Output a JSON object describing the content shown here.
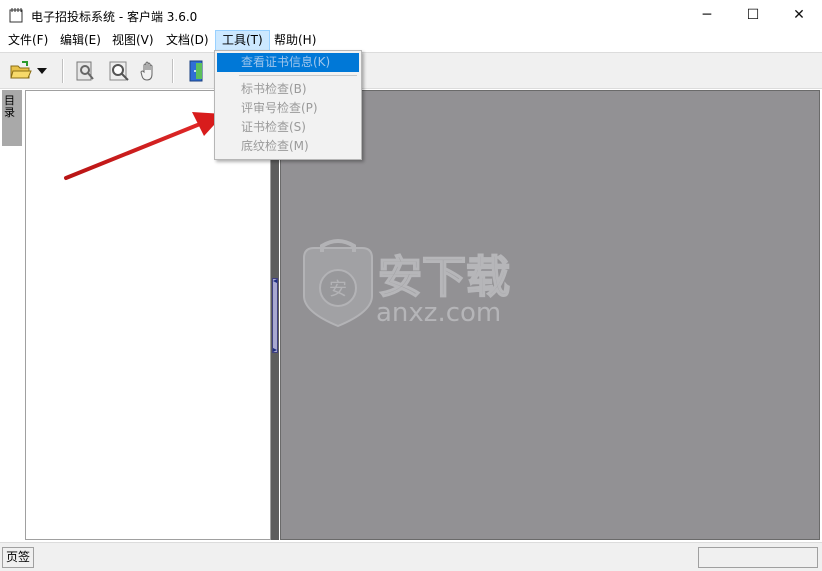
{
  "window": {
    "title": "电子招投标系统 - 客户端 3.6.0",
    "minimize_glyph": "─",
    "maximize_glyph": "☐",
    "close_glyph": "✕"
  },
  "menubar": {
    "items": [
      {
        "label": "文件(F)"
      },
      {
        "label": "编辑(E)"
      },
      {
        "label": "视图(V)"
      },
      {
        "label": "文档(D)"
      },
      {
        "label": "工具(T)",
        "active": true
      },
      {
        "label": "帮助(H)"
      }
    ]
  },
  "tools_menu": {
    "items": [
      {
        "label": "查看证书信息(K)",
        "highlighted": true
      },
      {
        "label": "标书检查(B)",
        "enabled": false
      },
      {
        "label": "评审号检查(P)",
        "enabled": false
      },
      {
        "label": "证书检查(S)",
        "enabled": false
      },
      {
        "label": "底纹检查(M)",
        "enabled": false
      }
    ]
  },
  "toolbar": {
    "icons": [
      "open-folder-icon",
      "dropdown-arrow-icon",
      "find-icon",
      "zoom-icon",
      "hand-icon",
      "exit-door-icon"
    ]
  },
  "side_tab": {
    "label": "目录"
  },
  "statusbar": {
    "page_tab_label": "页签"
  },
  "watermark": {
    "text": "anxz.com",
    "brand": "安下载"
  },
  "colors": {
    "menu_highlight": "#0078d7",
    "active_menu_bg": "#cce8ff",
    "document_area": "#929194",
    "arrow": "#d11a1a"
  }
}
